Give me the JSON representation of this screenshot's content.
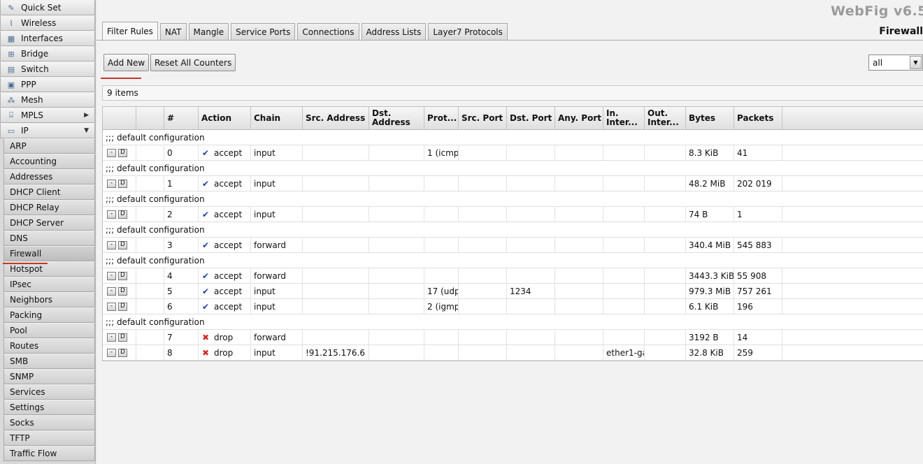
{
  "sidebar": {
    "items": [
      {
        "label": "Quick Set",
        "icon": "wand-icon",
        "glyph": "✎"
      },
      {
        "label": "Wireless",
        "icon": "antenna-icon",
        "glyph": "⌇"
      },
      {
        "label": "Interfaces",
        "icon": "interfaces-icon",
        "glyph": "▦"
      },
      {
        "label": "Bridge",
        "icon": "bridge-icon",
        "glyph": "⊞"
      },
      {
        "label": "Switch",
        "icon": "switch-icon",
        "glyph": "▤"
      },
      {
        "label": "PPP",
        "icon": "ppp-icon",
        "glyph": "▣"
      },
      {
        "label": "Mesh",
        "icon": "mesh-icon",
        "glyph": "⁂"
      },
      {
        "label": "MPLS",
        "icon": "mpls-icon",
        "glyph": "⌸"
      },
      {
        "label": "IP",
        "icon": "ip-icon",
        "glyph": "▭"
      }
    ],
    "ip_submenu": [
      "ARP",
      "Accounting",
      "Addresses",
      "DHCP Client",
      "DHCP Relay",
      "DHCP Server",
      "DNS",
      "Firewall",
      "Hotspot",
      "IPsec",
      "Neighbors",
      "Packing",
      "Pool",
      "Routes",
      "SMB",
      "SNMP",
      "Services",
      "Settings",
      "Socks",
      "TFTP",
      "Traffic Flow"
    ],
    "active_submenu": "Firewall"
  },
  "header": {
    "brand": "WebFig v6.5",
    "page_title": "Firewall"
  },
  "tabs": [
    "Filter Rules",
    "NAT",
    "Mangle",
    "Service Ports",
    "Connections",
    "Address Lists",
    "Layer7 Protocols"
  ],
  "active_tab": "Filter Rules",
  "toolbar": {
    "add_new": "Add New",
    "reset_counters": "Reset All Counters",
    "filter_value": "all"
  },
  "table": {
    "count_label": "9 items",
    "columns": [
      "",
      "",
      "#",
      "Action",
      "Chain",
      "Src. Address",
      "Dst. Address",
      "Prot...",
      "Src. Port",
      "Dst. Port",
      "Any. Port",
      "In. Inter...",
      "Out. Inter...",
      "Bytes",
      "Packets"
    ],
    "remove_label": "-",
    "disable_label": "D",
    "rows": [
      {
        "comment": ";;; default configuration",
        "num": "0",
        "action": "accept",
        "chain": "input",
        "src": "",
        "dst": "",
        "proto": "1 (icmp",
        "sport": "",
        "dport": "",
        "aport": "",
        "inif": "",
        "outif": "",
        "bytes": "8.3 KiB",
        "packets": "41"
      },
      {
        "comment": ";;; default configuration",
        "num": "1",
        "action": "accept",
        "chain": "input",
        "src": "",
        "dst": "",
        "proto": "",
        "sport": "",
        "dport": "",
        "aport": "",
        "inif": "",
        "outif": "",
        "bytes": "48.2 MiB",
        "packets": "202 019"
      },
      {
        "comment": ";;; default configuration",
        "num": "2",
        "action": "accept",
        "chain": "input",
        "src": "",
        "dst": "",
        "proto": "",
        "sport": "",
        "dport": "",
        "aport": "",
        "inif": "",
        "outif": "",
        "bytes": "74 B",
        "packets": "1"
      },
      {
        "comment": ";;; default configuration",
        "num": "3",
        "action": "accept",
        "chain": "forward",
        "src": "",
        "dst": "",
        "proto": "",
        "sport": "",
        "dport": "",
        "aport": "",
        "inif": "",
        "outif": "",
        "bytes": "340.4 MiB",
        "packets": "545 883"
      },
      {
        "comment": ";;; default configuration",
        "num": "4",
        "action": "accept",
        "chain": "forward",
        "src": "",
        "dst": "",
        "proto": "",
        "sport": "",
        "dport": "",
        "aport": "",
        "inif": "",
        "outif": "",
        "bytes": "3443.3 KiB",
        "packets": "55 908"
      },
      {
        "comment": "",
        "num": "5",
        "action": "accept",
        "chain": "input",
        "src": "",
        "dst": "",
        "proto": "17 (udp",
        "sport": "",
        "dport": "1234",
        "aport": "",
        "inif": "",
        "outif": "",
        "bytes": "979.3 MiB",
        "packets": "757 261"
      },
      {
        "comment": "",
        "num": "6",
        "action": "accept",
        "chain": "input",
        "src": "",
        "dst": "",
        "proto": "2 (igmp",
        "sport": "",
        "dport": "",
        "aport": "",
        "inif": "",
        "outif": "",
        "bytes": "6.1 KiB",
        "packets": "196"
      },
      {
        "comment": ";;; default configuration",
        "num": "7",
        "action": "drop",
        "chain": "forward",
        "src": "",
        "dst": "",
        "proto": "",
        "sport": "",
        "dport": "",
        "aport": "",
        "inif": "",
        "outif": "",
        "bytes": "3192 B",
        "packets": "14"
      },
      {
        "comment": "",
        "num": "8",
        "action": "drop",
        "chain": "input",
        "src": "!91.215.176.6",
        "dst": "",
        "proto": "",
        "sport": "",
        "dport": "",
        "aport": "",
        "inif": "ether1-ga",
        "outif": "",
        "bytes": "32.8 KiB",
        "packets": "259"
      }
    ]
  },
  "colors": {
    "accept_icon": "#1f3fa8",
    "drop_icon": "#d42a2a",
    "highlight_underline": "#c0392b"
  }
}
